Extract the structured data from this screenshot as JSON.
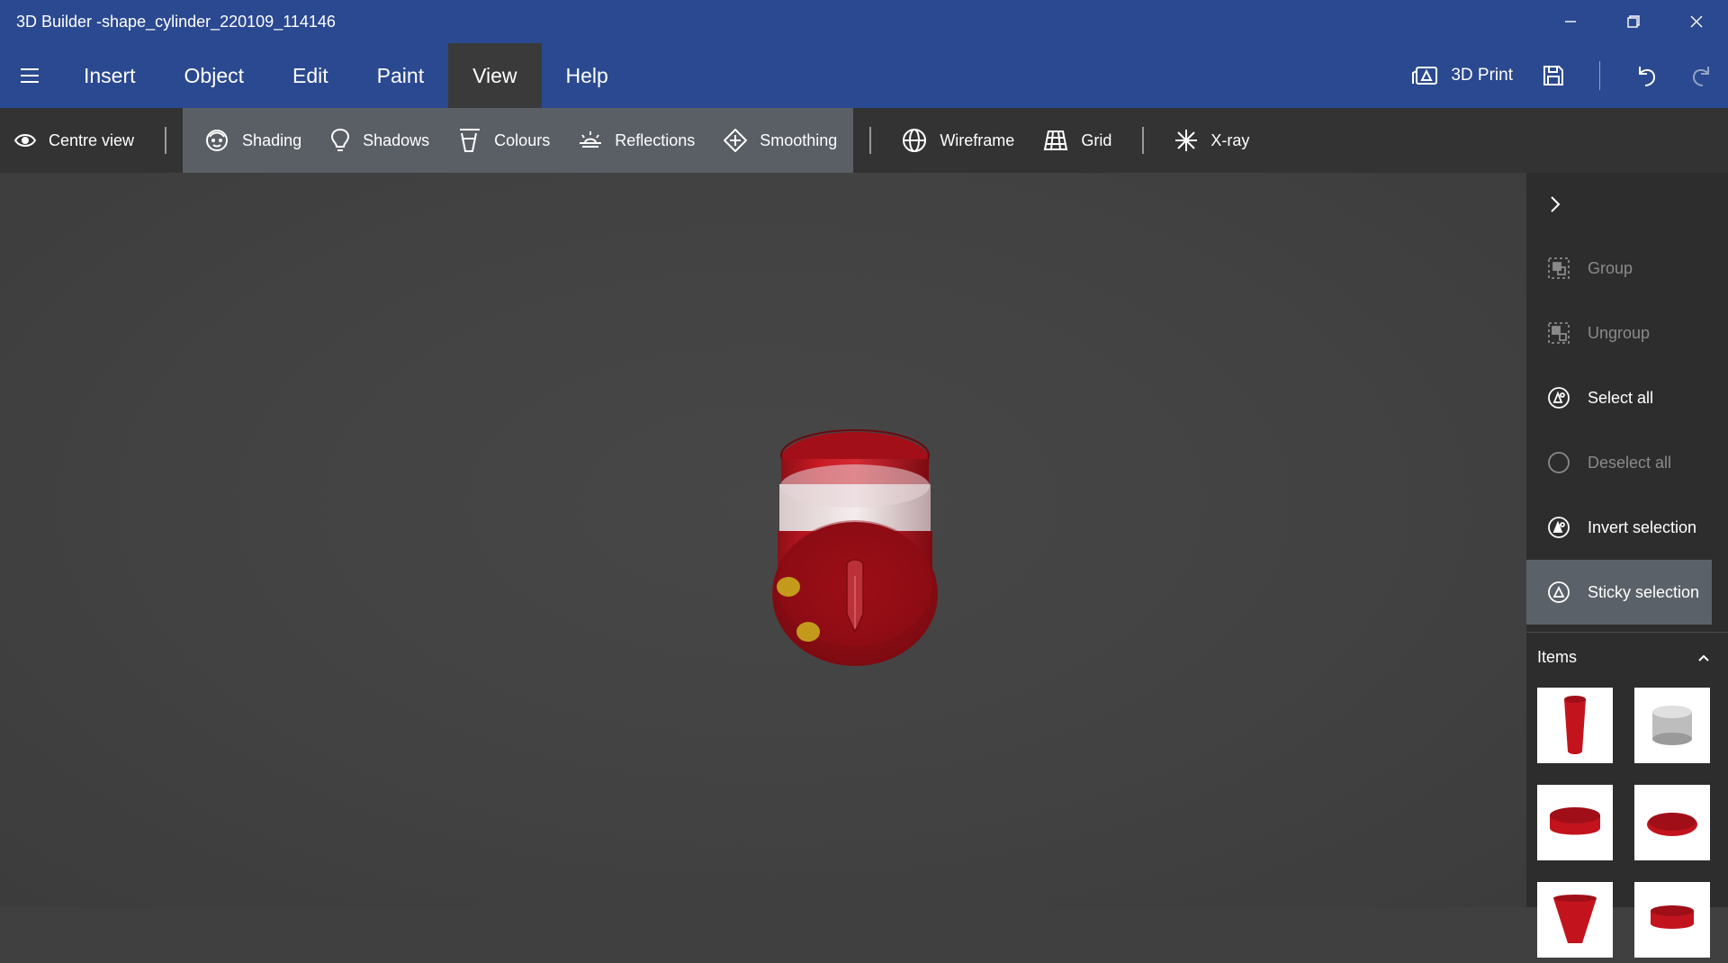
{
  "window": {
    "title": "3D Builder -shape_cylinder_220109_114146",
    "minimize_icon": "minimize-icon",
    "restore_icon": "restore-icon",
    "close_icon": "close-icon"
  },
  "menubar": {
    "tabs": [
      {
        "label": "Insert"
      },
      {
        "label": "Object"
      },
      {
        "label": "Edit"
      },
      {
        "label": "Paint"
      },
      {
        "label": "View",
        "active": true
      },
      {
        "label": "Help"
      }
    ],
    "print_label": "3D Print"
  },
  "toolbar": {
    "centre_view": "Centre view",
    "shading": "Shading",
    "shadows": "Shadows",
    "colours": "Colours",
    "reflections": "Reflections",
    "smoothing": "Smoothing",
    "wireframe": "Wireframe",
    "grid": "Grid",
    "xray": "X-ray"
  },
  "right_panel": {
    "actions": [
      {
        "label": "Group",
        "enabled": false
      },
      {
        "label": "Ungroup",
        "enabled": false
      },
      {
        "label": "Select all",
        "enabled": true
      },
      {
        "label": "Deselect all",
        "enabled": false
      },
      {
        "label": "Invert selection",
        "enabled": true
      },
      {
        "label": "Sticky selection",
        "enabled": true,
        "active": true
      }
    ],
    "items_header": "Items"
  },
  "colors": {
    "titlebar": "#2b4990",
    "toolbar": "#333333",
    "viewport": "#434343",
    "model_red": "#b3121c",
    "marker_gold": "#c49a1c"
  }
}
